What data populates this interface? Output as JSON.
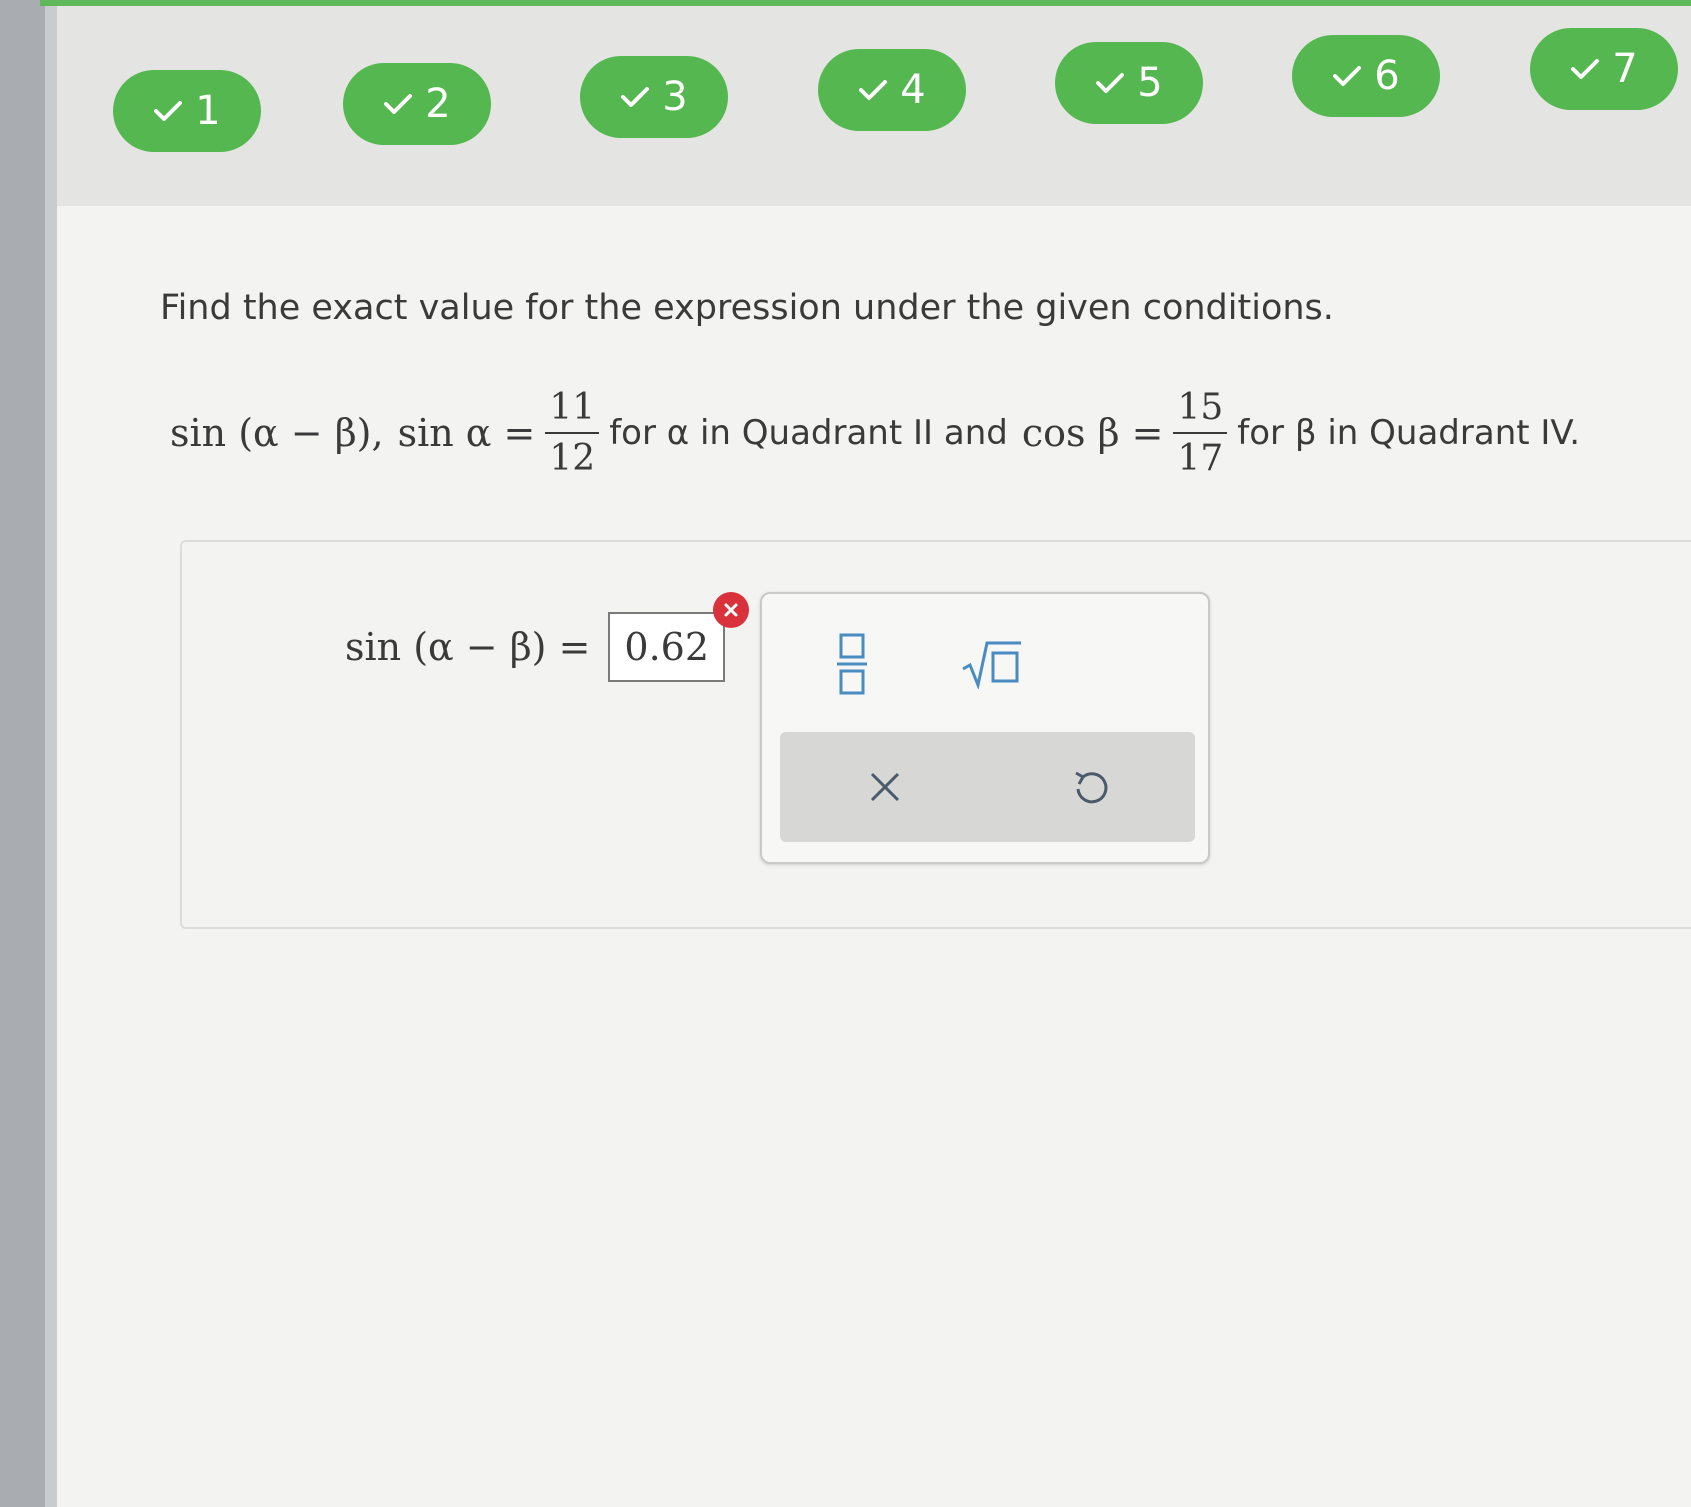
{
  "question_nav": {
    "items": [
      {
        "label": "1",
        "status": "correct"
      },
      {
        "label": "2",
        "status": "correct"
      },
      {
        "label": "3",
        "status": "correct"
      },
      {
        "label": "4",
        "status": "correct"
      },
      {
        "label": "5",
        "status": "correct"
      },
      {
        "label": "6",
        "status": "correct"
      },
      {
        "label": "7",
        "status": "correct"
      }
    ],
    "pill_color": "#54b74f"
  },
  "problem": {
    "prompt": "Find the exact value for the expression under the given conditions.",
    "expression": "sin (α − β),",
    "sin_alpha_label": "sin α =",
    "alpha_fraction": {
      "numerator": "11",
      "denominator": "12"
    },
    "alpha_condition": "for α in Quadrant II and",
    "cos_beta_label": "cos β =",
    "beta_fraction": {
      "numerator": "15",
      "denominator": "17"
    },
    "beta_condition": "for β in Quadrant IV."
  },
  "answer": {
    "label": "sin (α − β) =",
    "value": "0.62",
    "status": "incorrect",
    "status_color": "#d9323c"
  },
  "keypad": {
    "buttons": [
      "fraction-template",
      "square-root-template"
    ],
    "tools": [
      "clear",
      "undo"
    ]
  }
}
